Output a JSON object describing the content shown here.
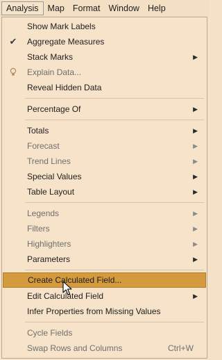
{
  "menubar": {
    "items": [
      {
        "label": "Analysis",
        "active": true
      },
      {
        "label": "Map"
      },
      {
        "label": "Format"
      },
      {
        "label": "Window"
      },
      {
        "label": "Help"
      }
    ]
  },
  "menu": {
    "show_mark_labels": "Show Mark Labels",
    "aggregate_measures": "Aggregate Measures",
    "stack_marks": "Stack Marks",
    "explain_data": "Explain Data...",
    "reveal_hidden_data": "Reveal Hidden Data",
    "percentage_of": "Percentage Of",
    "totals": "Totals",
    "forecast": "Forecast",
    "trend_lines": "Trend Lines",
    "special_values": "Special Values",
    "table_layout": "Table Layout",
    "legends": "Legends",
    "filters": "Filters",
    "highlighters": "Highlighters",
    "parameters": "Parameters",
    "create_calculated_field": "Create Calculated Field...",
    "edit_calculated_field": "Edit Calculated Field",
    "infer_properties": "Infer Properties from Missing Values",
    "cycle_fields": "Cycle Fields",
    "swap_rows_columns": "Swap Rows and Columns",
    "swap_shortcut": "Ctrl+W"
  },
  "icons": {
    "check": "checkmark-icon",
    "bulb": "lightbulb-icon",
    "submenu": "chevron-right-icon",
    "cursor": "mouse-pointer-icon"
  },
  "colors": {
    "menu_bg": "#f6e3c9",
    "highlight": "#d49a3e"
  }
}
